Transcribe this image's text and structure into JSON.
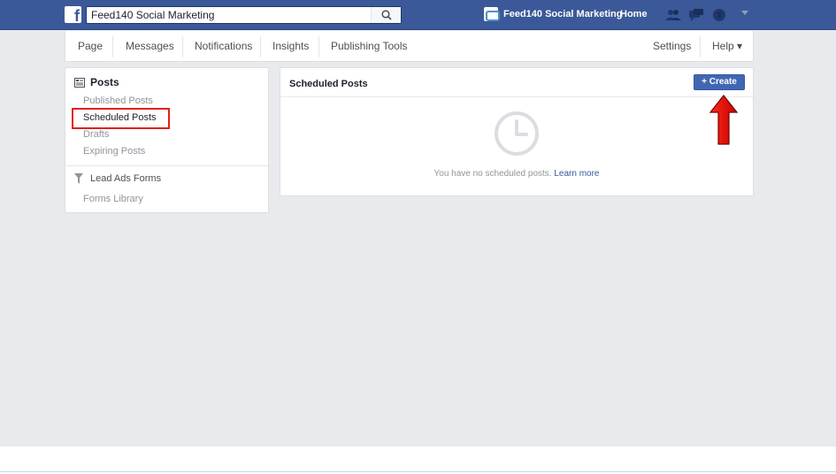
{
  "topbar": {
    "logo_letter": "f",
    "search_value": "Feed140 Social Marketing",
    "page_name": "Feed140 Social Marketing",
    "home_label": "Home",
    "brand_color": "#3b5998"
  },
  "subnav": {
    "items": [
      "Page",
      "Messages",
      "Notifications",
      "Insights",
      "Publishing Tools"
    ],
    "settings_label": "Settings",
    "help_label": "Help ▾"
  },
  "sidebar": {
    "posts_heading": "Posts",
    "items": [
      "Published Posts",
      "Scheduled Posts",
      "Drafts",
      "Expiring Posts"
    ],
    "lead_heading": "Lead Ads Forms",
    "lead_items": [
      "Forms Library"
    ]
  },
  "main": {
    "title": "Scheduled Posts",
    "create_label": "+ Create",
    "empty_text": "You have no scheduled posts.",
    "learn_more": "Learn more",
    "accent_color": "#4267b2"
  },
  "annotation": {
    "highlight_color": "#e0211b"
  }
}
